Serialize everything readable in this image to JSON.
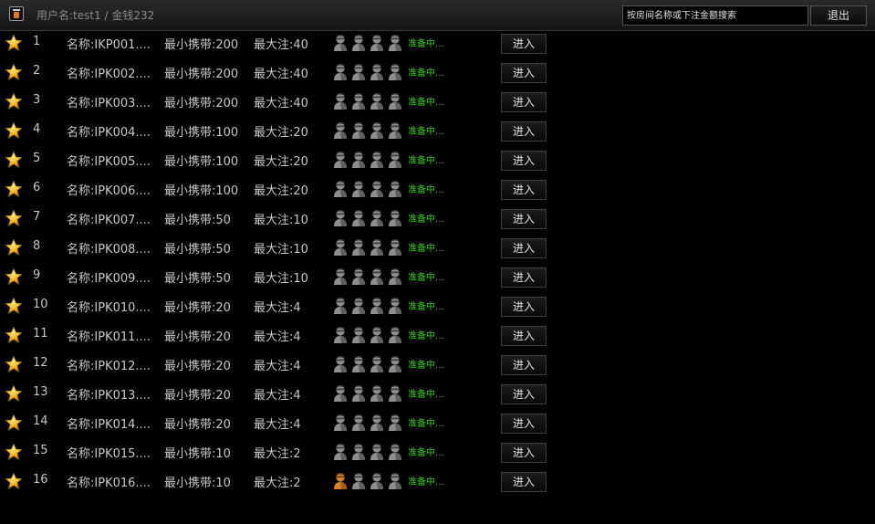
{
  "header": {
    "user_info": "用户名:test1 / 金钱232",
    "search_placeholder": "按房间名称或下注金额搜索",
    "search_value": "",
    "logout_label": "退出"
  },
  "icons": {
    "app": "app-icon",
    "favorite": "star-icon",
    "seat_empty": "seat-empty-icon",
    "seat_occupied": "seat-occupied-icon"
  },
  "colors": {
    "background": "#000000",
    "status": "#34d21c",
    "star": "#f6b21b",
    "seat_occupied": "#d9822b",
    "seat_empty": "#8a8a8a"
  },
  "rooms": [
    {
      "index": "1",
      "name": "名称:IKP001....",
      "min": "最小携带:200",
      "max": "最大注:40",
      "status": "准备中...",
      "seats": [
        false,
        false,
        false,
        false
      ],
      "enter_label": "进入"
    },
    {
      "index": "2",
      "name": "名称:IPK002....",
      "min": "最小携带:200",
      "max": "最大注:40",
      "status": "准备中...",
      "seats": [
        false,
        false,
        false,
        false
      ],
      "enter_label": "进入"
    },
    {
      "index": "3",
      "name": "名称:IPK003....",
      "min": "最小携带:200",
      "max": "最大注:40",
      "status": "准备中...",
      "seats": [
        false,
        false,
        false,
        false
      ],
      "enter_label": "进入"
    },
    {
      "index": "4",
      "name": "名称:IPK004....",
      "min": "最小携带:100",
      "max": "最大注:20",
      "status": "准备中...",
      "seats": [
        false,
        false,
        false,
        false
      ],
      "enter_label": "进入"
    },
    {
      "index": "5",
      "name": "名称:IPK005....",
      "min": "最小携带:100",
      "max": "最大注:20",
      "status": "准备中...",
      "seats": [
        false,
        false,
        false,
        false
      ],
      "enter_label": "进入"
    },
    {
      "index": "6",
      "name": "名称:IPK006....",
      "min": "最小携带:100",
      "max": "最大注:20",
      "status": "准备中...",
      "seats": [
        false,
        false,
        false,
        false
      ],
      "enter_label": "进入"
    },
    {
      "index": "7",
      "name": "名称:IPK007....",
      "min": "最小携带:50",
      "max": "最大注:10",
      "status": "准备中...",
      "seats": [
        false,
        false,
        false,
        false
      ],
      "enter_label": "进入"
    },
    {
      "index": "8",
      "name": "名称:IPK008....",
      "min": "最小携带:50",
      "max": "最大注:10",
      "status": "准备中...",
      "seats": [
        false,
        false,
        false,
        false
      ],
      "enter_label": "进入"
    },
    {
      "index": "9",
      "name": "名称:IPK009....",
      "min": "最小携带:50",
      "max": "最大注:10",
      "status": "准备中...",
      "seats": [
        false,
        false,
        false,
        false
      ],
      "enter_label": "进入"
    },
    {
      "index": "10",
      "name": "名称:IPK010....",
      "min": "最小携带:20",
      "max": "最大注:4",
      "status": "准备中...",
      "seats": [
        false,
        false,
        false,
        false
      ],
      "enter_label": "进入"
    },
    {
      "index": "11",
      "name": "名称:IPK011....",
      "min": "最小携带:20",
      "max": "最大注:4",
      "status": "准备中...",
      "seats": [
        false,
        false,
        false,
        false
      ],
      "enter_label": "进入"
    },
    {
      "index": "12",
      "name": "名称:IPK012....",
      "min": "最小携带:20",
      "max": "最大注:4",
      "status": "准备中...",
      "seats": [
        false,
        false,
        false,
        false
      ],
      "enter_label": "进入"
    },
    {
      "index": "13",
      "name": "名称:IPK013....",
      "min": "最小携带:20",
      "max": "最大注:4",
      "status": "准备中...",
      "seats": [
        false,
        false,
        false,
        false
      ],
      "enter_label": "进入"
    },
    {
      "index": "14",
      "name": "名称:IPK014....",
      "min": "最小携带:20",
      "max": "最大注:4",
      "status": "准备中...",
      "seats": [
        false,
        false,
        false,
        false
      ],
      "enter_label": "进入"
    },
    {
      "index": "15",
      "name": "名称:IPK015....",
      "min": "最小携带:10",
      "max": "最大注:2",
      "status": "准备中...",
      "seats": [
        false,
        false,
        false,
        false
      ],
      "enter_label": "进入"
    },
    {
      "index": "16",
      "name": "名称:IPK016....",
      "min": "最小携带:10",
      "max": "最大注:2",
      "status": "准备中...",
      "seats": [
        true,
        false,
        false,
        false
      ],
      "enter_label": "进入"
    }
  ]
}
